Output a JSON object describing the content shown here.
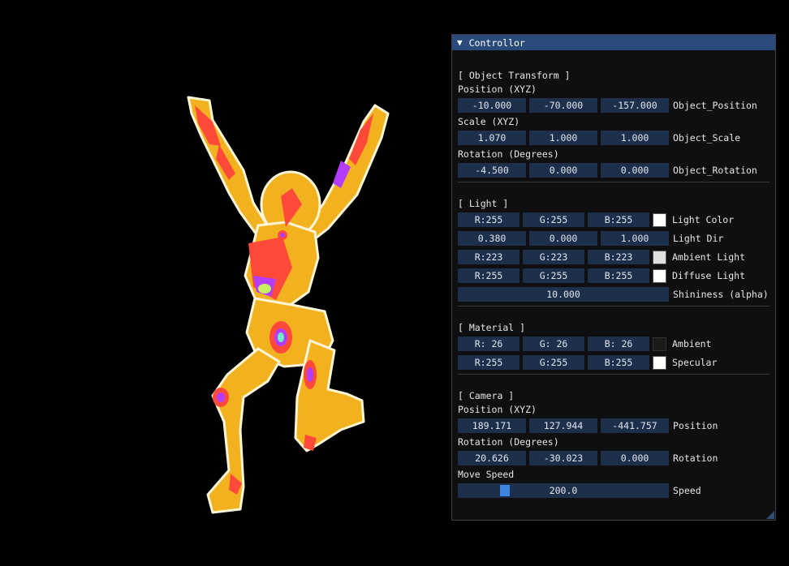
{
  "window": {
    "title": "Controllor",
    "collapse_icon": "triangle-down-icon"
  },
  "object_transform": {
    "header": "[ Object Transform ]",
    "position_label": "Position (XYZ)",
    "position": [
      "-10.000",
      "-70.000",
      "-157.000"
    ],
    "position_name": "Object_Position",
    "scale_label": "Scale (XYZ)",
    "scale": [
      "1.070",
      "1.000",
      "1.000"
    ],
    "scale_name": "Object_Scale",
    "rotation_label": "Rotation (Degrees)",
    "rotation": [
      "-4.500",
      "0.000",
      "0.000"
    ],
    "rotation_name": "Object_Rotation"
  },
  "light": {
    "header": "[ Light ]",
    "color": [
      "R:255",
      "G:255",
      "B:255"
    ],
    "color_label": "Light Color",
    "color_swatch": "#ffffff",
    "dir": [
      "0.380",
      "0.000",
      "1.000"
    ],
    "dir_label": "Light Dir",
    "ambient": [
      "R:223",
      "G:223",
      "B:223"
    ],
    "ambient_label": "Ambient Light",
    "ambient_swatch": "#dfdfdf",
    "diffuse": [
      "R:255",
      "G:255",
      "B:255"
    ],
    "diffuse_label": "Diffuse Light",
    "diffuse_swatch": "#ffffff",
    "shininess": "10.000",
    "shininess_label": "Shininess (alpha)"
  },
  "material": {
    "header": "[ Material ]",
    "ambient": [
      "R: 26",
      "G: 26",
      "B: 26"
    ],
    "ambient_label": "Ambient",
    "ambient_swatch": "#1a1a1a",
    "specular": [
      "R:255",
      "G:255",
      "B:255"
    ],
    "specular_label": "Specular",
    "specular_swatch": "#ffffff"
  },
  "camera": {
    "header": "[ Camera ]",
    "position_label": "Position (XYZ)",
    "position": [
      "189.171",
      "127.944",
      "-441.757"
    ],
    "position_name": "Position",
    "rotation_label": "Rotation (Degrees)",
    "rotation": [
      "20.626",
      "-30.023",
      "0.000"
    ],
    "rotation_name": "Rotation",
    "speed_label": "Move Speed",
    "speed": "200.0",
    "speed_name": "Speed",
    "speed_fraction": 0.21
  },
  "colors": {
    "titlebar": "#294a7a",
    "field": "#1d2f4a",
    "slider_grab": "#3d85e0",
    "model_yellow": "#f2b21f",
    "model_red": "#ff4a3a",
    "model_magenta": "#b43cff"
  }
}
